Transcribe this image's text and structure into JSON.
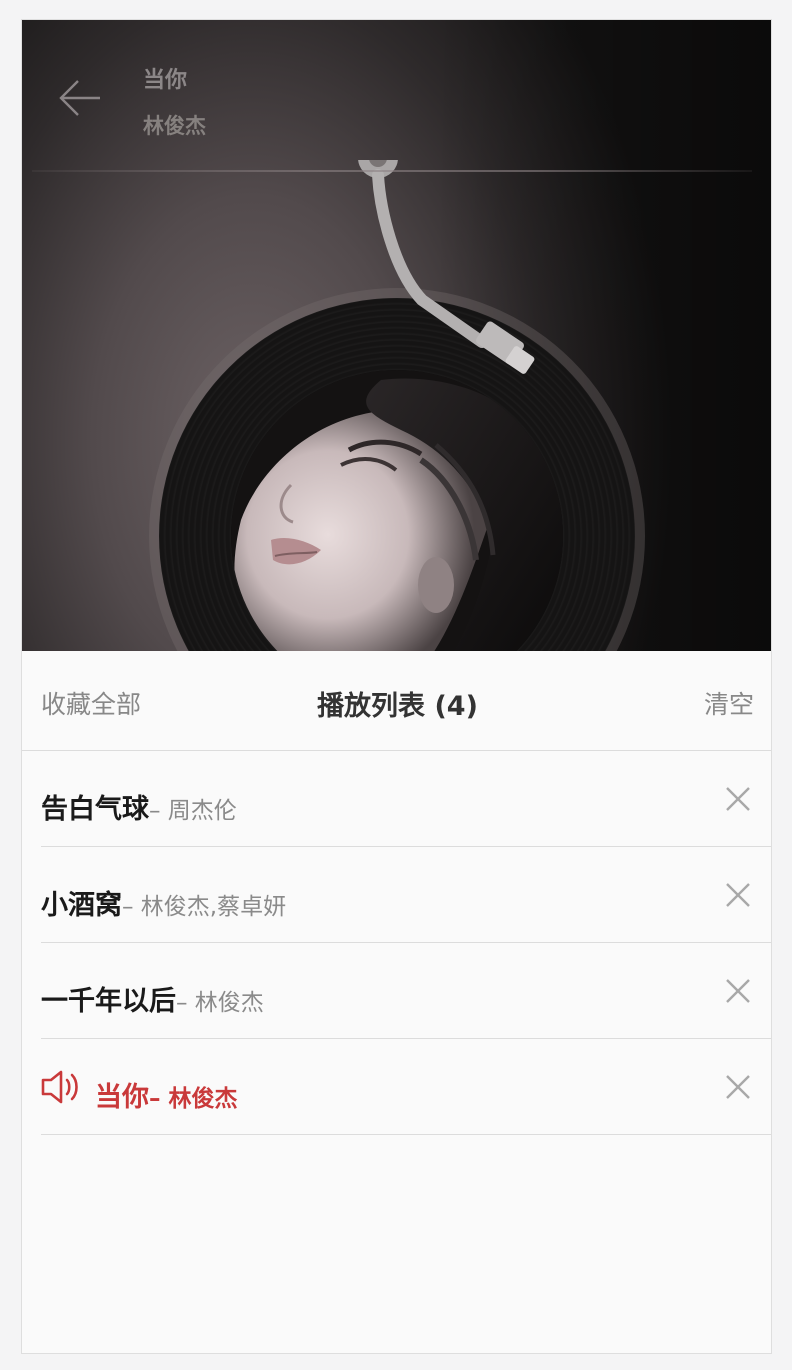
{
  "player": {
    "title": "当你",
    "artist": "林俊杰"
  },
  "playlist": {
    "collect_all_label": "收藏全部",
    "title": "播放列表 (4)",
    "clear_label": "清空",
    "items": [
      {
        "title": "告白气球",
        "artist": "– 周杰伦",
        "playing": false
      },
      {
        "title": "小酒窝",
        "artist": "– 林俊杰,蔡卓妍",
        "playing": false
      },
      {
        "title": "一千年以后",
        "artist": "– 林俊杰",
        "playing": false
      },
      {
        "title": "当你",
        "artist": "– 林俊杰",
        "playing": true
      }
    ]
  },
  "colors": {
    "accent": "#c9393a",
    "text_primary": "#1a1a1a",
    "text_secondary": "#8a8a8a",
    "divider": "#dcdcdc"
  },
  "icons": {
    "back": "arrow-left-icon",
    "close": "close-icon",
    "speaker": "speaker-icon",
    "tonearm": "tonearm-icon"
  }
}
